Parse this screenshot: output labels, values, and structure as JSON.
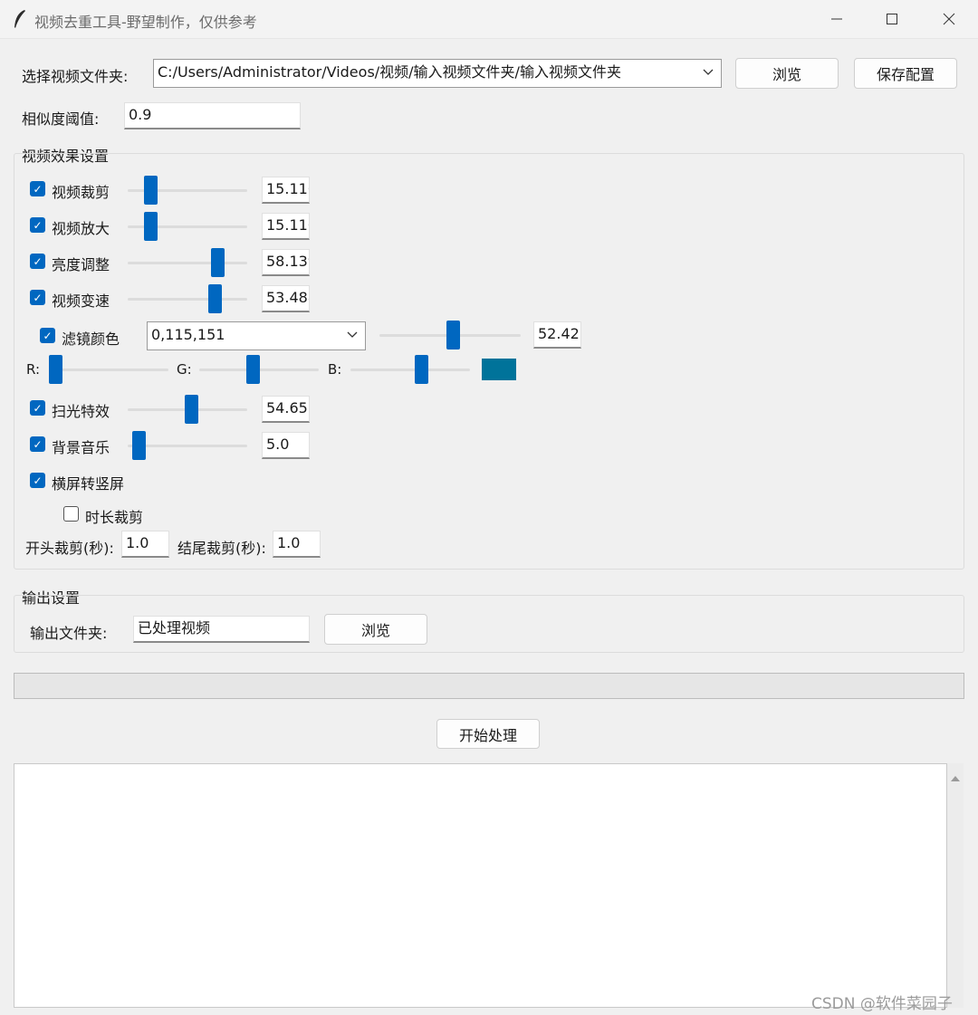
{
  "window": {
    "title": "视频去重工具-野望制作，仅供参考",
    "buttons": [
      "—",
      "☐",
      "✕"
    ]
  },
  "top": {
    "folder_label": "选择视频文件夹:",
    "folder_value": "C:/Users/Administrator/Videos/视频/输入视频文件夹/输入视频文件夹",
    "browse_label": "浏览",
    "save_label": "保存配置",
    "threshold_label": "相似度阈值:",
    "threshold_value": "0.9"
  },
  "effects": {
    "group_label": "视频效果设置",
    "items": [
      {
        "label": "视频裁剪",
        "checked": true,
        "level": 0.19,
        "value": "15.116"
      },
      {
        "label": "视频放大",
        "checked": true,
        "level": 0.19,
        "value": "15.116"
      },
      {
        "label": "亮度调整",
        "checked": true,
        "level": 0.75,
        "value": "58.139"
      },
      {
        "label": "视频变速",
        "checked": true,
        "level": 0.73,
        "value": "53.488"
      },
      {
        "label": "扫光特效",
        "checked": true,
        "level": 0.53,
        "value": "54.651"
      },
      {
        "label": "背景音乐",
        "checked": true,
        "level": 0.09,
        "value": "5.0"
      }
    ],
    "filter": {
      "label": "滤镜颜色",
      "checked": true,
      "combo_value": "0,115,151",
      "level": 0.52,
      "value": "52.427"
    },
    "rgb": {
      "r_label": "R:",
      "g_label": "G:",
      "b_label": "B:",
      "r_level": 0.0,
      "g_level": 0.45,
      "b_level": 0.59,
      "swatch_color": "#00739a"
    },
    "landscape": {
      "label": "横屏转竖屏",
      "checked": true
    },
    "duration": {
      "label": "时长裁剪",
      "checked": false
    },
    "head_label": "开头裁剪(秒):",
    "head_value": "1.0",
    "tail_label": "结尾裁剪(秒):",
    "tail_value": "1.0"
  },
  "output": {
    "group_label": "输出设置",
    "folder_label": "输出文件夹:",
    "folder_value": "已处理视频",
    "browse_label": "浏览"
  },
  "progress": 0,
  "start_label": "开始处理",
  "watermark": "CSDN @软件菜园子",
  "colors": {
    "accent": "#0067c0",
    "background": "#f0f0f0"
  }
}
